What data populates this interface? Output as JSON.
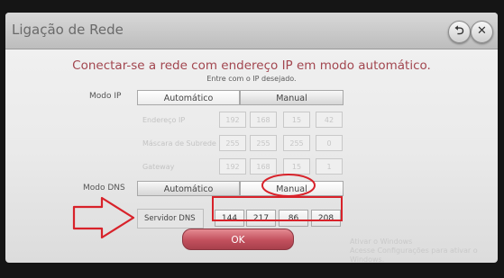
{
  "window": {
    "title": "Ligação de Rede",
    "back_icon": "back-arrow-icon",
    "close_icon": "close-icon"
  },
  "heading": {
    "main": "Conectar-se a rede com endereço IP em modo automático.",
    "sub": "Entre com o IP desejado."
  },
  "ip_mode": {
    "label": "Modo IP",
    "options": [
      "Automático",
      "Manual"
    ],
    "selected": "Automático"
  },
  "ip_settings": [
    {
      "label": "Endereço IP",
      "values": [
        "192",
        "168",
        "15",
        "42"
      ]
    },
    {
      "label": "Máscara de Subrede",
      "values": [
        "255",
        "255",
        "255",
        "0"
      ]
    },
    {
      "label": "Gateway",
      "values": [
        "192",
        "168",
        "15",
        "1"
      ]
    }
  ],
  "dns_mode": {
    "label": "Modo DNS",
    "options": [
      "Automático",
      "Manual"
    ],
    "selected": "Manual"
  },
  "dns_server": {
    "label": "Servidor DNS",
    "values": [
      "144",
      "217",
      "86",
      "208"
    ]
  },
  "ok_label": "OK",
  "watermark": [
    "Ativar o Windows",
    "Acesse Configurações para ativar o Windows."
  ],
  "colors": {
    "heading": "#a2464f",
    "ok_button": "#c2505d",
    "annotation": "#d8222a"
  }
}
